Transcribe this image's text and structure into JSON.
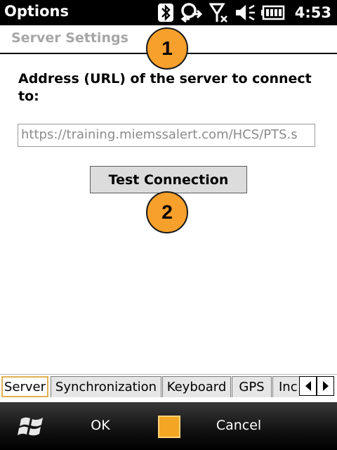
{
  "status_bar": {
    "title": "Options",
    "time": "4:53",
    "icons": [
      "bluetooth-icon",
      "sync-icon",
      "signal-icon",
      "speaker-icon",
      "battery-icon"
    ]
  },
  "section_header": "Server Settings",
  "address_label": "Address (URL) of the server to connect to:",
  "url_field": {
    "value": "https://training.miemssalert.com/HCS/PTS.s"
  },
  "test_button_label": "Test Connection",
  "callouts": [
    "1",
    "2"
  ],
  "tabs": {
    "items": [
      {
        "label": "Server",
        "active": true
      },
      {
        "label": "Synchronization",
        "active": false
      },
      {
        "label": "Keyboard",
        "active": false
      },
      {
        "label": "GPS",
        "active": false
      },
      {
        "label": "Inc",
        "active": false
      }
    ]
  },
  "softkeys": {
    "left": "OK",
    "right": "Cancel"
  },
  "colors": {
    "callout": "#f7a02b",
    "active_tab_border": "#e2b052",
    "header_gray": "#a6a6a6"
  }
}
